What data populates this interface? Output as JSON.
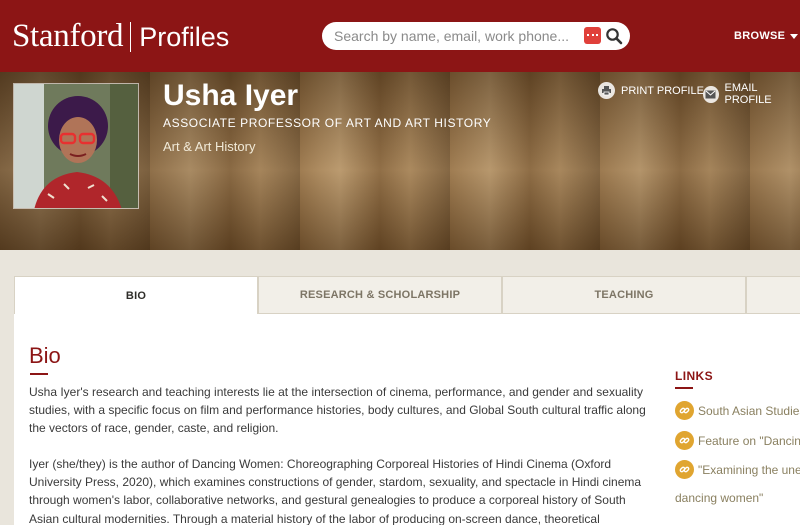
{
  "header": {
    "brand_name": "Stanford",
    "brand_product": "Profiles",
    "search_placeholder": "Search by name, email, work phone...",
    "browse_label": "BROWSE"
  },
  "profile": {
    "name": "Usha Iyer",
    "title": "ASSOCIATE PROFESSOR OF ART AND ART HISTORY",
    "department": "Art & Art History",
    "actions": {
      "print": "PRINT PROFILE",
      "email": "EMAIL PROFILE"
    }
  },
  "tabs": [
    {
      "label": "BIO",
      "active": true
    },
    {
      "label": "RESEARCH & SCHOLARSHIP",
      "active": false
    },
    {
      "label": "TEACHING",
      "active": false
    }
  ],
  "bio": {
    "heading": "Bio",
    "paragraph1": "Usha Iyer's research and teaching interests lie at the intersection of cinema, performance, and gender and sexuality studies, with a specific focus on film and performance histories, body cultures, and Global South cultural traffic along the vectors of race, gender, caste, and religion.",
    "paragraph2": "Iyer (she/they) is the author of Dancing Women: Choreographing Corporeal Histories of Hindi Cinema (Oxford University Press, 2020), which examines constructions of gender, stardom, sexuality, and spectacle in Hindi cinema through women's labor, collaborative networks, and gestural genealogies to produce a corporeal history of South Asian cultural modernities. Through a material history of the labor of producing on-screen dance, theoretical frameworks that emphasize collaboration, aesthetic"
  },
  "links": {
    "heading": "LINKS",
    "items": [
      "South Asian Studies a",
      "Feature on \"Dancing W",
      "\"Examining the unex"
    ],
    "continuation": "dancing women\""
  },
  "colors": {
    "cardinal": "#8c1515",
    "link_icon": "#e0a530"
  }
}
